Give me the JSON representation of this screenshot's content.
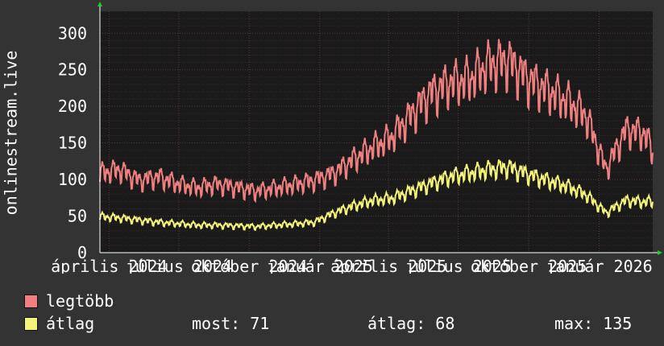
{
  "chart_data": {
    "type": "line",
    "ylabel": "onlinestream.live",
    "yticks": [
      0,
      50,
      100,
      150,
      200,
      250,
      300
    ],
    "ylim": [
      0,
      330
    ],
    "xlim": [
      "2024-03-20",
      "2026-03-12"
    ],
    "xticks": [
      {
        "label": "április 2024",
        "date": "2024-04-01"
      },
      {
        "label": "július 2024",
        "date": "2024-07-01"
      },
      {
        "label": "október 2024",
        "date": "2024-10-01"
      },
      {
        "label": "január 2025",
        "date": "2025-01-01"
      },
      {
        "label": "április 2025",
        "date": "2025-04-01"
      },
      {
        "label": "július 2025",
        "date": "2025-07-01"
      },
      {
        "label": "október 2025",
        "date": "2025-10-01"
      },
      {
        "label": "január 2026",
        "date": "2026-01-01"
      }
    ],
    "grid": true,
    "colors": {
      "background": "#333333",
      "plot": "#1a1a1a",
      "grid": "#5a3a3a",
      "axis": "#ffffff",
      "legtobb": "#f08080",
      "atlag": "#f4f47a"
    },
    "series": [
      {
        "name": "legtöbb",
        "color": "#f08080",
        "values": [
          {
            "x": "2024-03-20",
            "y": 110
          },
          {
            "x": "2024-04-15",
            "y": 115
          },
          {
            "x": "2024-05-10",
            "y": 100
          },
          {
            "x": "2024-06-05",
            "y": 105
          },
          {
            "x": "2024-07-01",
            "y": 95
          },
          {
            "x": "2024-07-25",
            "y": 90
          },
          {
            "x": "2024-08-20",
            "y": 95
          },
          {
            "x": "2024-09-15",
            "y": 90
          },
          {
            "x": "2024-10-10",
            "y": 85
          },
          {
            "x": "2024-11-05",
            "y": 90
          },
          {
            "x": "2024-12-01",
            "y": 95
          },
          {
            "x": "2024-12-25",
            "y": 100
          },
          {
            "x": "2025-01-20",
            "y": 110
          },
          {
            "x": "2025-02-15",
            "y": 130
          },
          {
            "x": "2025-03-10",
            "y": 145
          },
          {
            "x": "2025-04-05",
            "y": 160
          },
          {
            "x": "2025-04-30",
            "y": 190
          },
          {
            "x": "2025-05-25",
            "y": 220
          },
          {
            "x": "2025-06-20",
            "y": 235
          },
          {
            "x": "2025-07-15",
            "y": 240
          },
          {
            "x": "2025-08-10",
            "y": 260
          },
          {
            "x": "2025-09-05",
            "y": 265
          },
          {
            "x": "2025-09-30",
            "y": 240
          },
          {
            "x": "2025-10-25",
            "y": 225
          },
          {
            "x": "2025-11-20",
            "y": 210
          },
          {
            "x": "2025-12-15",
            "y": 190
          },
          {
            "x": "2026-01-10",
            "y": 115
          },
          {
            "x": "2026-02-05",
            "y": 170
          },
          {
            "x": "2026-03-01",
            "y": 165
          },
          {
            "x": "2026-03-12",
            "y": 140
          }
        ]
      },
      {
        "name": "átlag",
        "color": "#f4f47a",
        "values": [
          {
            "x": "2024-03-20",
            "y": 50
          },
          {
            "x": "2024-04-15",
            "y": 48
          },
          {
            "x": "2024-05-10",
            "y": 45
          },
          {
            "x": "2024-06-05",
            "y": 42
          },
          {
            "x": "2024-07-01",
            "y": 40
          },
          {
            "x": "2024-07-25",
            "y": 38
          },
          {
            "x": "2024-08-20",
            "y": 38
          },
          {
            "x": "2024-09-15",
            "y": 37
          },
          {
            "x": "2024-10-10",
            "y": 36
          },
          {
            "x": "2024-11-05",
            "y": 38
          },
          {
            "x": "2024-12-01",
            "y": 40
          },
          {
            "x": "2024-12-25",
            "y": 42
          },
          {
            "x": "2025-01-20",
            "y": 55
          },
          {
            "x": "2025-02-15",
            "y": 65
          },
          {
            "x": "2025-03-10",
            "y": 72
          },
          {
            "x": "2025-04-05",
            "y": 75
          },
          {
            "x": "2025-04-30",
            "y": 85
          },
          {
            "x": "2025-05-25",
            "y": 95
          },
          {
            "x": "2025-06-20",
            "y": 105
          },
          {
            "x": "2025-07-15",
            "y": 110
          },
          {
            "x": "2025-08-10",
            "y": 115
          },
          {
            "x": "2025-09-05",
            "y": 118
          },
          {
            "x": "2025-09-30",
            "y": 108
          },
          {
            "x": "2025-10-25",
            "y": 100
          },
          {
            "x": "2025-11-20",
            "y": 92
          },
          {
            "x": "2025-12-15",
            "y": 80
          },
          {
            "x": "2026-01-10",
            "y": 55
          },
          {
            "x": "2026-02-05",
            "y": 72
          },
          {
            "x": "2026-03-01",
            "y": 70
          },
          {
            "x": "2026-03-12",
            "y": 71
          }
        ]
      }
    ]
  },
  "legend": {
    "items": [
      {
        "label": "legtöbb",
        "color": "#f08080"
      },
      {
        "label": "átlag",
        "color": "#f4f47a"
      }
    ],
    "stats": {
      "now": "most: 71",
      "avg": "átlag: 68",
      "max": "max: 135"
    }
  }
}
